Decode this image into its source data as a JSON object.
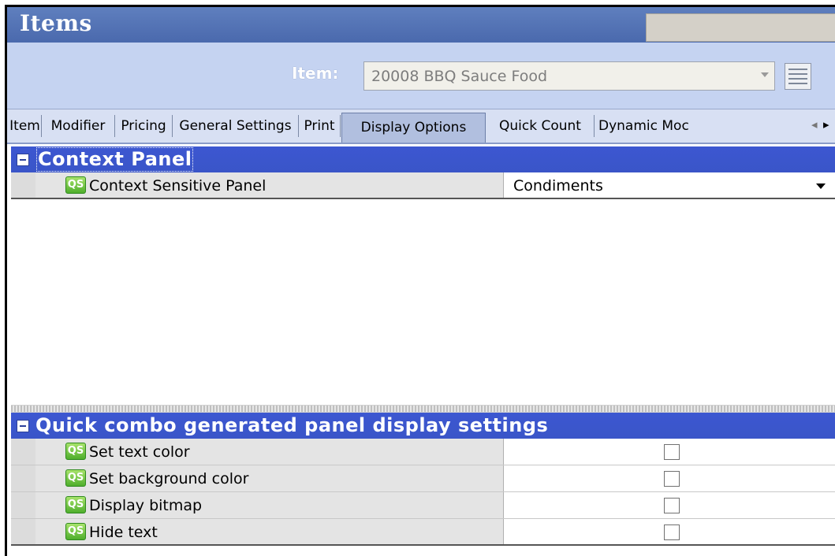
{
  "window": {
    "title": "Items"
  },
  "item_selector": {
    "label": "Item:",
    "value": "20008 BBQ Sauce Food"
  },
  "tabs": [
    {
      "label": "Item"
    },
    {
      "label": "Modifier"
    },
    {
      "label": "Pricing"
    },
    {
      "label": "General Settings"
    },
    {
      "label": "Print"
    },
    {
      "label": "Display Options",
      "active": true
    },
    {
      "label": "Quick Count"
    },
    {
      "label": "Dynamic Moc"
    }
  ],
  "tab_scroll": {
    "left": "◂",
    "right": "▸"
  },
  "context_panel": {
    "title": "Context Panel",
    "rows": [
      {
        "label": "Context Sensitive Panel",
        "value": "Condiments"
      }
    ]
  },
  "quick_combo": {
    "title": "Quick combo generated panel display settings",
    "rows": [
      {
        "label": "Set text color",
        "checked": false
      },
      {
        "label": "Set background color",
        "checked": false
      },
      {
        "label": "Display bitmap",
        "checked": false
      },
      {
        "label": "Hide text",
        "checked": false
      }
    ]
  },
  "icons": {
    "qs_badge_text": "QS"
  },
  "colors": {
    "title_bar": "#4a69ad",
    "section_header": "#3a55c8",
    "item_bar": "#c5d3f1"
  }
}
